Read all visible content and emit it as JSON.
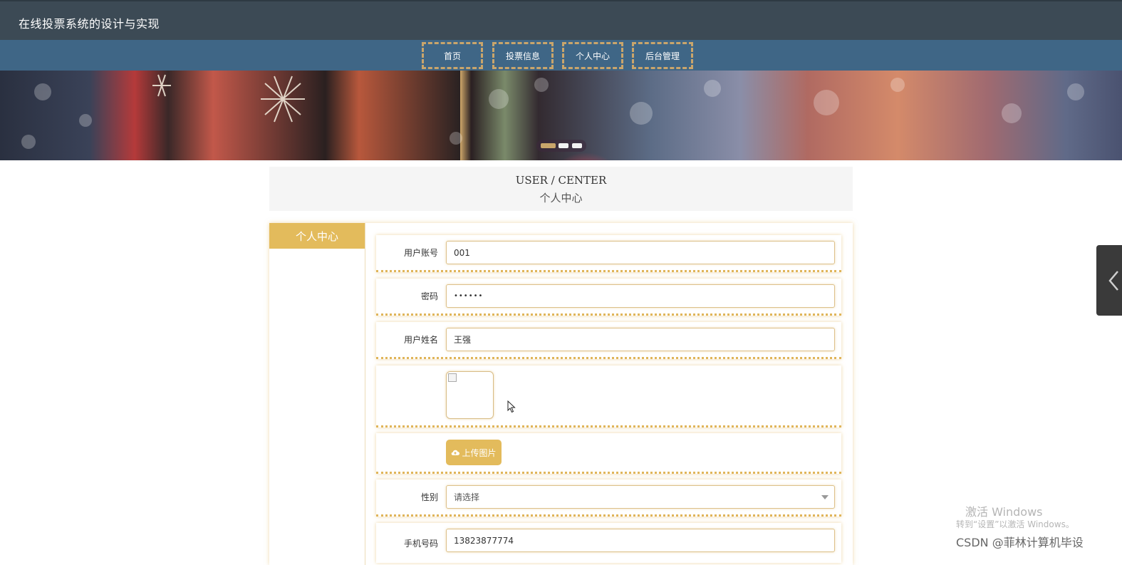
{
  "site": {
    "title": "在线投票系统的设计与实现"
  },
  "nav": {
    "items": [
      {
        "label": "首页"
      },
      {
        "label": "投票信息"
      },
      {
        "label": "个人中心"
      },
      {
        "label": "后台管理"
      }
    ]
  },
  "banner": {
    "slide_count": 3,
    "active_slide": 1
  },
  "section_header": {
    "en": "USER / CENTER",
    "cn": "个人中心"
  },
  "side_menu": {
    "title": "个人中心"
  },
  "form": {
    "account": {
      "label": "用户账号",
      "value": "001"
    },
    "password": {
      "label": "密码",
      "value": "••••••"
    },
    "name": {
      "label": "用户姓名",
      "value": "王强"
    },
    "upload": {
      "label": "上传图片"
    },
    "gender": {
      "label": "性别",
      "value": "请选择"
    },
    "phone": {
      "label": "手机号码",
      "value": "13823877774"
    }
  },
  "overlay": {
    "activate_title": "激活 Windows",
    "activate_sub": "转到“设置”以激活 Windows。",
    "csdn": "CSDN @菲林计算机毕设"
  },
  "colors": {
    "topbar": "#3c4a55",
    "navbar": "#3f6686",
    "accent_gold": "#e3bb5c",
    "nav_border": "#c9a56b"
  }
}
